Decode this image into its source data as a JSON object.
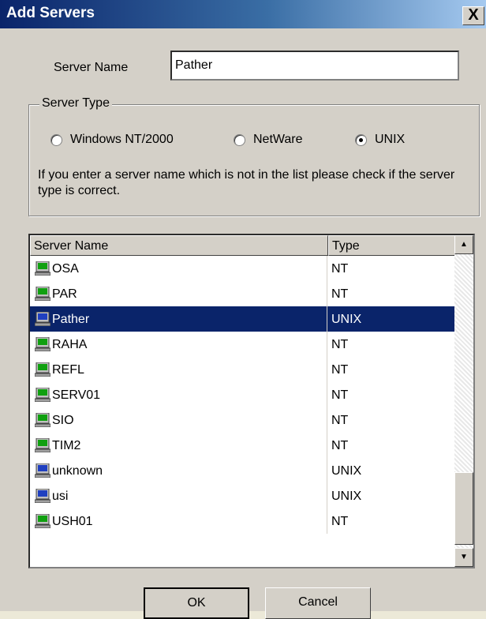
{
  "window": {
    "title": "Add Servers",
    "close_label": "X"
  },
  "form": {
    "server_name_label": "Server Name",
    "server_name_value": "Pather"
  },
  "server_type": {
    "legend": "Server Type",
    "options": [
      {
        "label": "Windows NT/2000",
        "selected": false
      },
      {
        "label": "NetWare",
        "selected": false
      },
      {
        "label": "UNIX",
        "selected": true
      }
    ],
    "hint": "If you enter a server name which is not in the list please check if the server type is correct."
  },
  "list": {
    "columns": [
      "Server Name",
      "Type"
    ],
    "rows": [
      {
        "name": "OSA",
        "type": "NT"
      },
      {
        "name": "PAR",
        "type": "NT"
      },
      {
        "name": "Pather",
        "type": "UNIX",
        "selected": true
      },
      {
        "name": "RAHA",
        "type": "NT"
      },
      {
        "name": "REFL",
        "type": "NT"
      },
      {
        "name": "SERV01",
        "type": "NT"
      },
      {
        "name": "SIO",
        "type": "NT"
      },
      {
        "name": "TIM2",
        "type": "NT"
      },
      {
        "name": "unknown",
        "type": "UNIX"
      },
      {
        "name": "usi",
        "type": "UNIX"
      },
      {
        "name": "USH01",
        "type": "NT"
      }
    ]
  },
  "buttons": {
    "ok": "OK",
    "cancel": "Cancel"
  },
  "colors": {
    "selection": "#0a246a",
    "title_bar": "#0a246a",
    "dialog_face": "#d4d0c8"
  },
  "icons": {
    "server_row": "computer-icon",
    "scroll_up": "arrow-up-icon",
    "scroll_down": "arrow-down-icon"
  }
}
